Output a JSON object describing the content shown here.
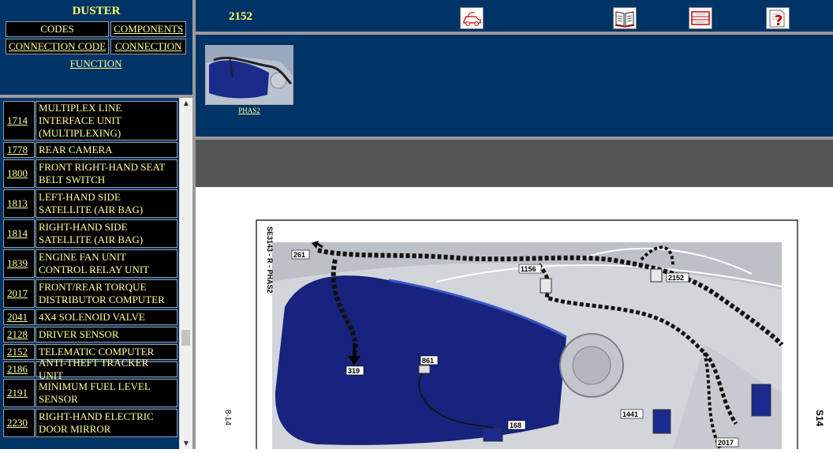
{
  "left": {
    "title": "DUSTER",
    "nav": {
      "codes": "CODES",
      "components": "COMPONENTS",
      "connection_code": "CONNECTION CODE",
      "connection": "CONNECTION",
      "function": "FUNCTION"
    },
    "components": [
      {
        "num": "1714",
        "desc": "MULTIPLEX LINE INTERFACE UNIT (MULTIPLEXING)"
      },
      {
        "num": "1778",
        "desc": "REAR CAMERA"
      },
      {
        "num": "1800",
        "desc": "FRONT RIGHT-HAND SEAT BELT SWITCH"
      },
      {
        "num": "1813",
        "desc": "LEFT-HAND SIDE SATELLITE (AIR BAG)"
      },
      {
        "num": "1814",
        "desc": "RIGHT-HAND SIDE SATELLITE (AIR BAG)"
      },
      {
        "num": "1839",
        "desc": "ENGINE FAN UNIT CONTROL RELAY UNIT"
      },
      {
        "num": "2017",
        "desc": "FRONT/REAR TORQUE DISTRIBUTOR COMPUTER"
      },
      {
        "num": "2041",
        "desc": "4X4 SOLENOID VALVE"
      },
      {
        "num": "2128",
        "desc": "DRIVER SENSOR"
      },
      {
        "num": "2152",
        "desc": "TELEMATIC COMPUTER"
      },
      {
        "num": "2186",
        "desc": "ANTI-THEFT TRACKER UNIT"
      },
      {
        "num": "2191",
        "desc": "MINIMUM FUEL LEVEL SENSOR"
      },
      {
        "num": "2230",
        "desc": "RIGHT-HAND ELECTRIC DOOR MIRROR"
      }
    ]
  },
  "right": {
    "code": "2152",
    "toolbar": [
      {
        "icon": "car-tag-icon"
      },
      {
        "icon": "open-book-icon"
      },
      {
        "icon": "wiring-diagram-icon"
      },
      {
        "icon": "help-document-icon"
      }
    ],
    "thumbnail_label": "PHAS2"
  },
  "diagram": {
    "side_code": "SE3143 - R - PHAS2",
    "page_left": "8-14",
    "page_right": "S14",
    "callouts": [
      "261",
      "1156",
      "2152",
      "319",
      "861",
      "168",
      "1441",
      "2017"
    ]
  },
  "colors": {
    "panel": "#003366",
    "text_yellow": "#ffff99",
    "title_yellow": "#ffff66",
    "separator": "#9a9a9a"
  }
}
